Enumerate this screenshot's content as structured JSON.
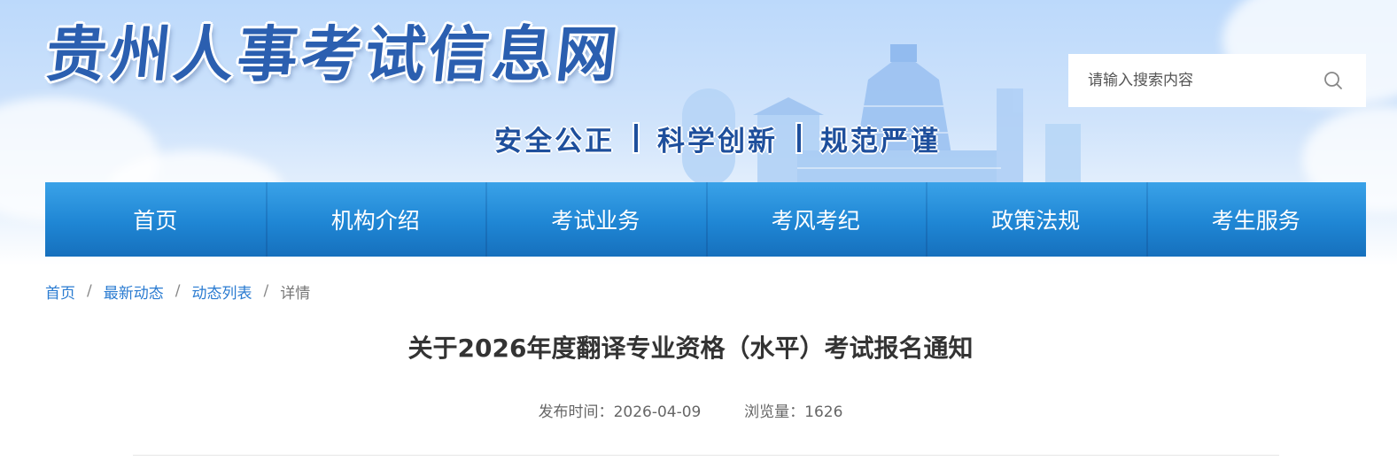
{
  "header": {
    "site_title": "贵州人事考试信息网",
    "slogan": [
      "安全公正",
      "科学创新",
      "规范严谨"
    ]
  },
  "search": {
    "placeholder": "请输入搜索内容",
    "icon": "search-icon"
  },
  "nav": {
    "items": [
      {
        "label": "首页"
      },
      {
        "label": "机构介绍"
      },
      {
        "label": "考试业务"
      },
      {
        "label": "考风考纪"
      },
      {
        "label": "政策法规"
      },
      {
        "label": "考生服务"
      }
    ]
  },
  "breadcrumb": {
    "items": [
      "首页",
      "最新动态",
      "动态列表"
    ],
    "separator": "/",
    "current": "详情"
  },
  "article": {
    "title": "关于2026年度翻译专业资格（水平）考试报名通知",
    "publish_label": "发布时间：",
    "publish_date": "2026-04-09",
    "views_label": "浏览量：",
    "views": "1626"
  },
  "colors": {
    "nav_blue": "#1f86d4",
    "title_blue": "#2b5fb0",
    "link_blue": "#2a7bd1"
  }
}
